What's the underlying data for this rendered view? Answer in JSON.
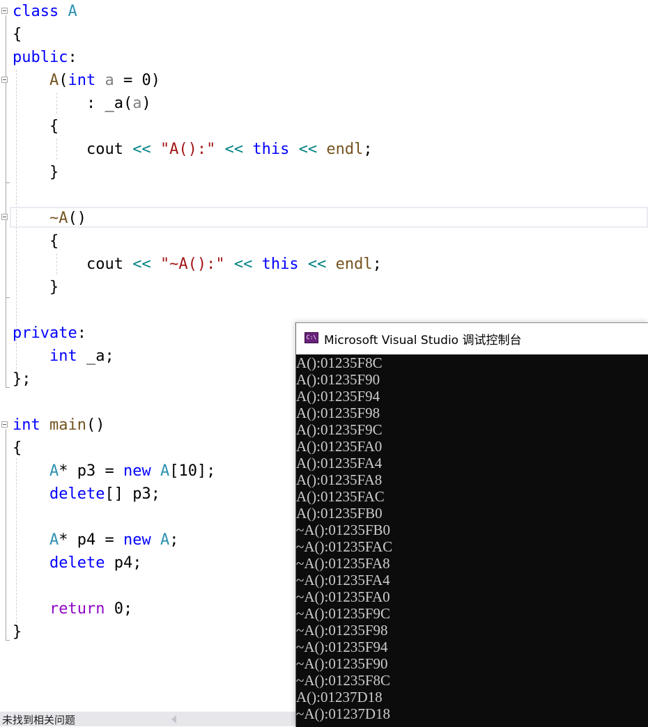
{
  "editor": {
    "lines": [
      [
        {
          "t": "class",
          "c": "kw"
        },
        {
          "t": " ",
          "c": "tx"
        },
        {
          "t": "A",
          "c": "ty"
        }
      ],
      [
        {
          "t": "{",
          "c": "tx"
        }
      ],
      [
        {
          "t": "public",
          "c": "kw"
        },
        {
          "t": ":",
          "c": "tx"
        }
      ],
      [
        {
          "t": "    ",
          "c": "tx"
        },
        {
          "t": "A",
          "c": "fn"
        },
        {
          "t": "(",
          "c": "tx"
        },
        {
          "t": "int",
          "c": "kw"
        },
        {
          "t": " ",
          "c": "tx"
        },
        {
          "t": "a",
          "c": "pa"
        },
        {
          "t": " = 0)",
          "c": "tx"
        }
      ],
      [
        {
          "t": "        : _a(",
          "c": "tx"
        },
        {
          "t": "a",
          "c": "pa"
        },
        {
          "t": ")",
          "c": "tx"
        }
      ],
      [
        {
          "t": "    {",
          "c": "tx"
        }
      ],
      [
        {
          "t": "        cout ",
          "c": "tx"
        },
        {
          "t": "<<",
          "c": "op"
        },
        {
          "t": " ",
          "c": "tx"
        },
        {
          "t": "\"A():\"",
          "c": "st"
        },
        {
          "t": " ",
          "c": "tx"
        },
        {
          "t": "<<",
          "c": "op"
        },
        {
          "t": " ",
          "c": "tx"
        },
        {
          "t": "this",
          "c": "kw"
        },
        {
          "t": " ",
          "c": "tx"
        },
        {
          "t": "<<",
          "c": "op"
        },
        {
          "t": " ",
          "c": "tx"
        },
        {
          "t": "endl",
          "c": "fn"
        },
        {
          "t": ";",
          "c": "tx"
        }
      ],
      [
        {
          "t": "    }",
          "c": "tx"
        }
      ],
      [],
      [
        {
          "t": "    ",
          "c": "tx"
        },
        {
          "t": "~A",
          "c": "fn"
        },
        {
          "t": "()",
          "c": "tx"
        }
      ],
      [
        {
          "t": "    {",
          "c": "tx"
        }
      ],
      [
        {
          "t": "        cout ",
          "c": "tx"
        },
        {
          "t": "<<",
          "c": "op"
        },
        {
          "t": " ",
          "c": "tx"
        },
        {
          "t": "\"~A():\"",
          "c": "st"
        },
        {
          "t": " ",
          "c": "tx"
        },
        {
          "t": "<<",
          "c": "op"
        },
        {
          "t": " ",
          "c": "tx"
        },
        {
          "t": "this",
          "c": "kw"
        },
        {
          "t": " ",
          "c": "tx"
        },
        {
          "t": "<<",
          "c": "op"
        },
        {
          "t": " ",
          "c": "tx"
        },
        {
          "t": "endl",
          "c": "fn"
        },
        {
          "t": ";",
          "c": "tx"
        }
      ],
      [
        {
          "t": "    }",
          "c": "tx"
        }
      ],
      [],
      [
        {
          "t": "private",
          "c": "kw"
        },
        {
          "t": ":",
          "c": "tx"
        }
      ],
      [
        {
          "t": "    ",
          "c": "tx"
        },
        {
          "t": "int",
          "c": "kw"
        },
        {
          "t": " _a;",
          "c": "tx"
        }
      ],
      [
        {
          "t": "};",
          "c": "tx"
        }
      ],
      [],
      [
        {
          "t": "int",
          "c": "kw"
        },
        {
          "t": " ",
          "c": "tx"
        },
        {
          "t": "main",
          "c": "fn"
        },
        {
          "t": "()",
          "c": "tx"
        }
      ],
      [
        {
          "t": "{",
          "c": "tx"
        }
      ],
      [
        {
          "t": "    ",
          "c": "tx"
        },
        {
          "t": "A",
          "c": "ty"
        },
        {
          "t": "* p3 = ",
          "c": "tx"
        },
        {
          "t": "new",
          "c": "kw"
        },
        {
          "t": " ",
          "c": "tx"
        },
        {
          "t": "A",
          "c": "ty"
        },
        {
          "t": "[10];",
          "c": "tx"
        }
      ],
      [
        {
          "t": "    ",
          "c": "tx"
        },
        {
          "t": "delete",
          "c": "kw"
        },
        {
          "t": "[] p3;",
          "c": "tx"
        }
      ],
      [],
      [
        {
          "t": "    ",
          "c": "tx"
        },
        {
          "t": "A",
          "c": "ty"
        },
        {
          "t": "* p4 = ",
          "c": "tx"
        },
        {
          "t": "new",
          "c": "kw"
        },
        {
          "t": " ",
          "c": "tx"
        },
        {
          "t": "A",
          "c": "ty"
        },
        {
          "t": ";",
          "c": "tx"
        }
      ],
      [
        {
          "t": "    ",
          "c": "tx"
        },
        {
          "t": "delete",
          "c": "kw"
        },
        {
          "t": " p4;",
          "c": "tx"
        }
      ],
      [],
      [
        {
          "t": "    ",
          "c": "tx"
        },
        {
          "t": "return",
          "c": "ret"
        },
        {
          "t": " 0;",
          "c": "tx"
        }
      ],
      [
        {
          "t": "}",
          "c": "tx"
        }
      ]
    ]
  },
  "status_bar": {
    "message": "未找到相关问题"
  },
  "console": {
    "icon_label": "C:\\",
    "title": "Microsoft Visual Studio 调试控制台",
    "output": [
      "A():01235F8C",
      "A():01235F90",
      "A():01235F94",
      "A():01235F98",
      "A():01235F9C",
      "A():01235FA0",
      "A():01235FA4",
      "A():01235FA8",
      "A():01235FAC",
      "A():01235FB0",
      "~A():01235FB0",
      "~A():01235FAC",
      "~A():01235FA8",
      "~A():01235FA4",
      "~A():01235FA0",
      "~A():01235F9C",
      "~A():01235F98",
      "~A():01235F94",
      "~A():01235F90",
      "~A():01235F8C",
      "A():01237D18",
      "~A():01237D18"
    ]
  }
}
